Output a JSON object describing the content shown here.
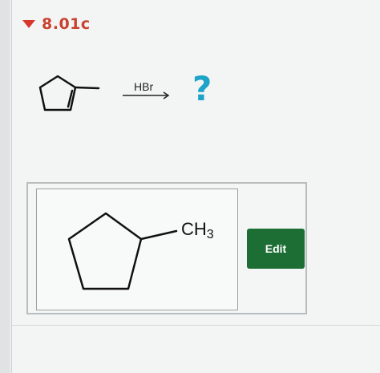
{
  "header": {
    "question_id": "8.01c",
    "accent_color": "#d9362b"
  },
  "reaction": {
    "reagent": "HBr",
    "product_placeholder": "?",
    "placeholder_color": "#1ea3c9"
  },
  "answer": {
    "substituent_label": "CH",
    "substituent_subscript": "3",
    "edit_label": "Edit",
    "edit_color": "#1d6e34"
  }
}
